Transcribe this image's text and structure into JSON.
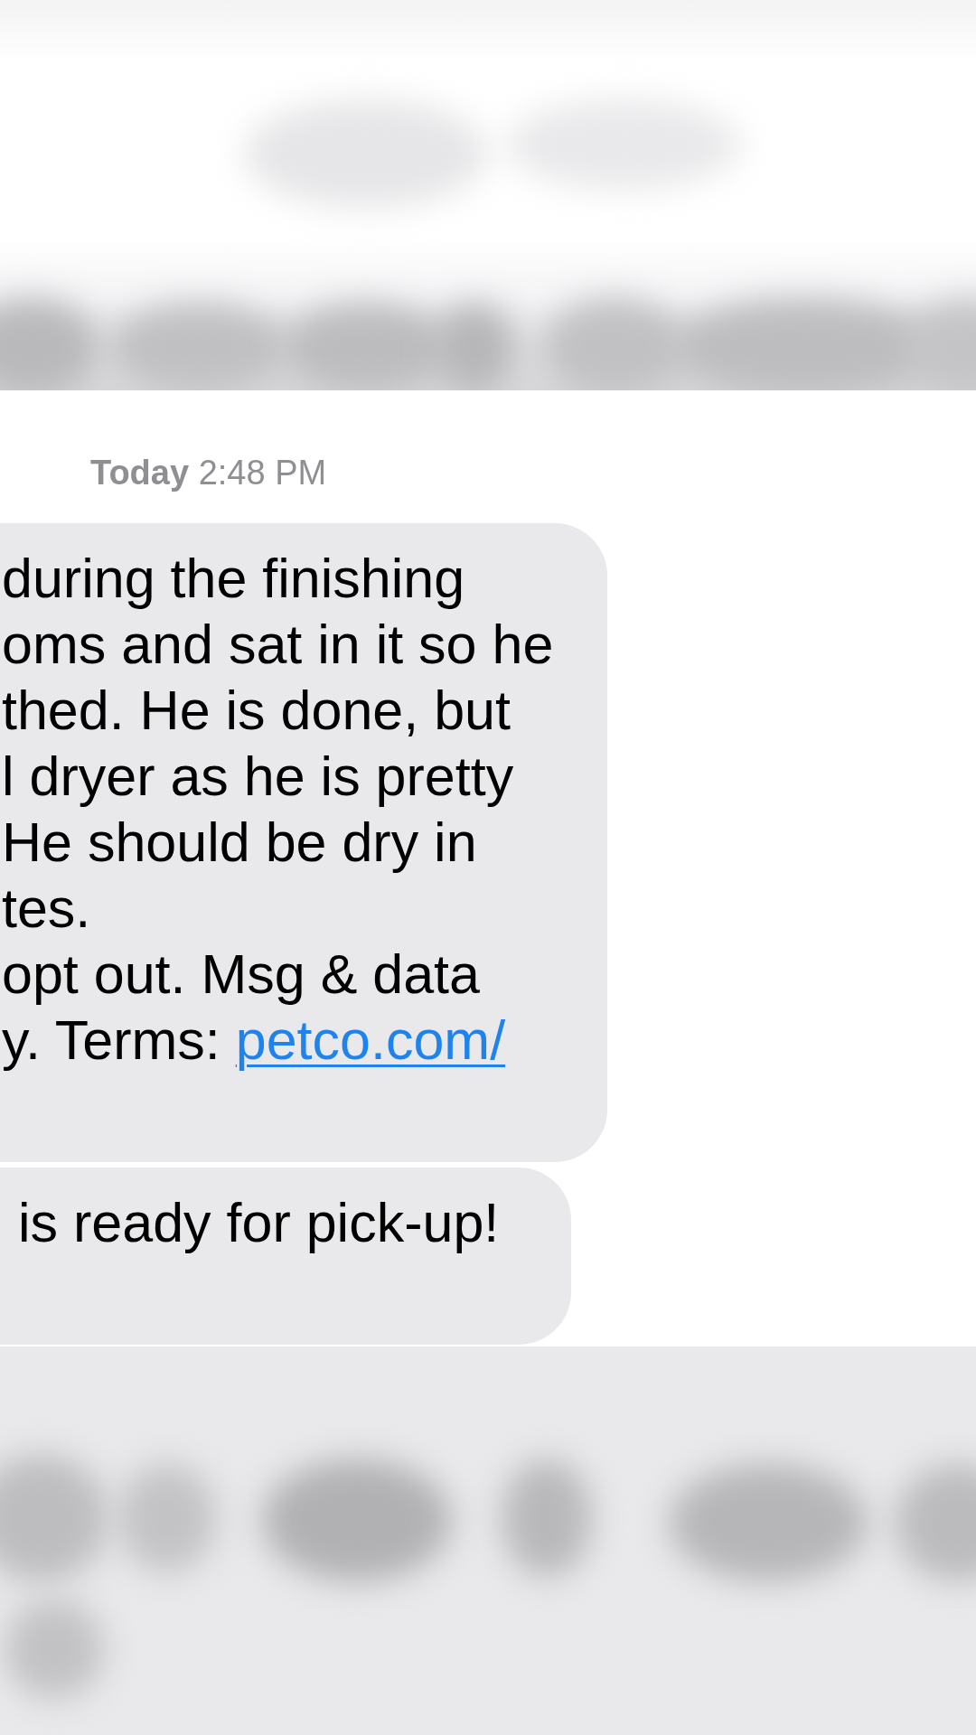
{
  "conversation": {
    "timestamp": "**Today** 2:48 PM",
    "messages": [
      {
        "lines": [
          {
            "text": "during the finishing"
          },
          {
            "text": "oms and sat in it so he"
          },
          {
            "text": "thed. He is done, but"
          },
          {
            "text": "l dryer as he is pretty"
          },
          {
            "text": "He should be dry in"
          },
          {
            "text": "tes."
          },
          {
            "text": "opt out. Msg & data"
          },
          {
            "text": "y. Terms:",
            "link": "petco.com/"
          }
        ]
      },
      {
        "lines": [
          {
            "text": "is ready for pick-up!"
          }
        ]
      }
    ]
  }
}
